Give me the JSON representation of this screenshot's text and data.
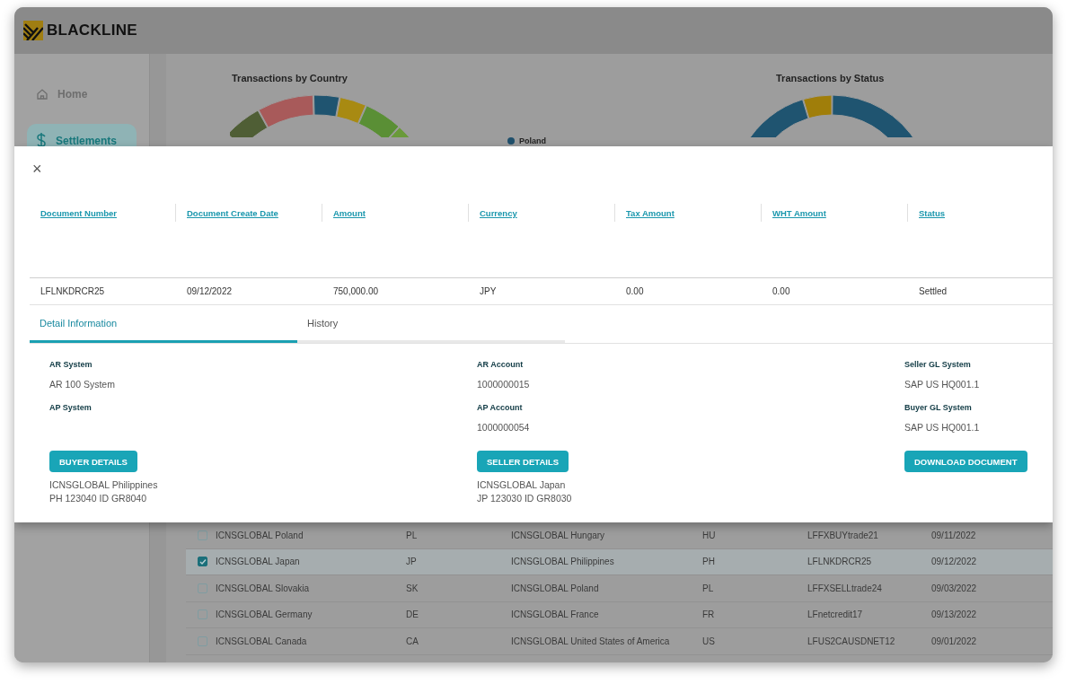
{
  "header": {
    "logo": "BLACKLINE"
  },
  "sidebar": {
    "items": [
      {
        "label": "Home",
        "selected": false
      },
      {
        "label": "Settlements",
        "selected": true
      }
    ]
  },
  "charts": [
    {
      "title": "Transactions by Country",
      "kind": "country"
    },
    {
      "title": "Transactions by Status",
      "kind": "status"
    }
  ],
  "legend": [
    {
      "label": "Poland",
      "color": "#1f4f6b"
    }
  ],
  "table": {
    "rows": [
      {
        "cells": [
          "ICNSGLOBAL Poland",
          "PL",
          "ICNSGLOBAL Hungary",
          "HU",
          "LFFXBUYtrade21",
          "09/11/2022"
        ],
        "checked": false,
        "selected": false
      },
      {
        "cells": [
          "ICNSGLOBAL Japan",
          "JP",
          "ICNSGLOBAL Philippines",
          "PH",
          "LFLNKDRCR25",
          "09/12/2022"
        ],
        "checked": true,
        "selected": true
      },
      {
        "cells": [
          "ICNSGLOBAL Slovakia",
          "SK",
          "ICNSGLOBAL Poland",
          "PL",
          "LFFXSELLtrade24",
          "09/03/2022"
        ],
        "checked": false,
        "selected": false
      },
      {
        "cells": [
          "ICNSGLOBAL Germany",
          "DE",
          "ICNSGLOBAL France",
          "FR",
          "LFnetcredit17",
          "09/13/2022"
        ],
        "checked": false,
        "selected": false
      },
      {
        "cells": [
          "ICNSGLOBAL Canada",
          "CA",
          "ICNSGLOBAL United States of America",
          "US",
          "LFUS2CAUSDNET12",
          "09/01/2022"
        ],
        "checked": false,
        "selected": false
      }
    ]
  },
  "modal": {
    "close": "×",
    "columns": [
      "Document Number",
      "Document Create Date",
      "Amount",
      "Currency",
      "Tax Amount",
      "WHT Amount",
      "Status"
    ],
    "row": [
      "LFLNKDRCR25",
      "09/12/2022",
      "750,000.00",
      "JPY",
      "0.00",
      "0.00",
      "Settled"
    ],
    "tabs": [
      {
        "label": "Detail Information",
        "selected": true
      },
      {
        "label": "History",
        "selected": false
      }
    ],
    "details": [
      {
        "fields": [
          {
            "label": "AR System",
            "value": "AR 100 System"
          },
          {
            "label": "AP System"
          }
        ],
        "button": "BUYER DETAILS",
        "lines": [
          "ICNSGLOBAL Philippines",
          "PH 123040 ID GR8040"
        ]
      },
      {
        "fields": [
          {
            "label": "AR Account",
            "value": "1000000015"
          },
          {
            "label": "AP Account",
            "value": "1000000054"
          }
        ],
        "button": "SELLER DETAILS",
        "lines": [
          "ICNSGLOBAL Japan",
          "JP 123030 ID GR8030"
        ]
      },
      {
        "fields": [
          {
            "label": "Seller GL System",
            "value": "SAP US HQ001.1"
          },
          {
            "label": "Buyer GL System",
            "value": "SAP US HQ001.1"
          }
        ],
        "button": "DOWNLOAD DOCUMENT"
      }
    ]
  }
}
